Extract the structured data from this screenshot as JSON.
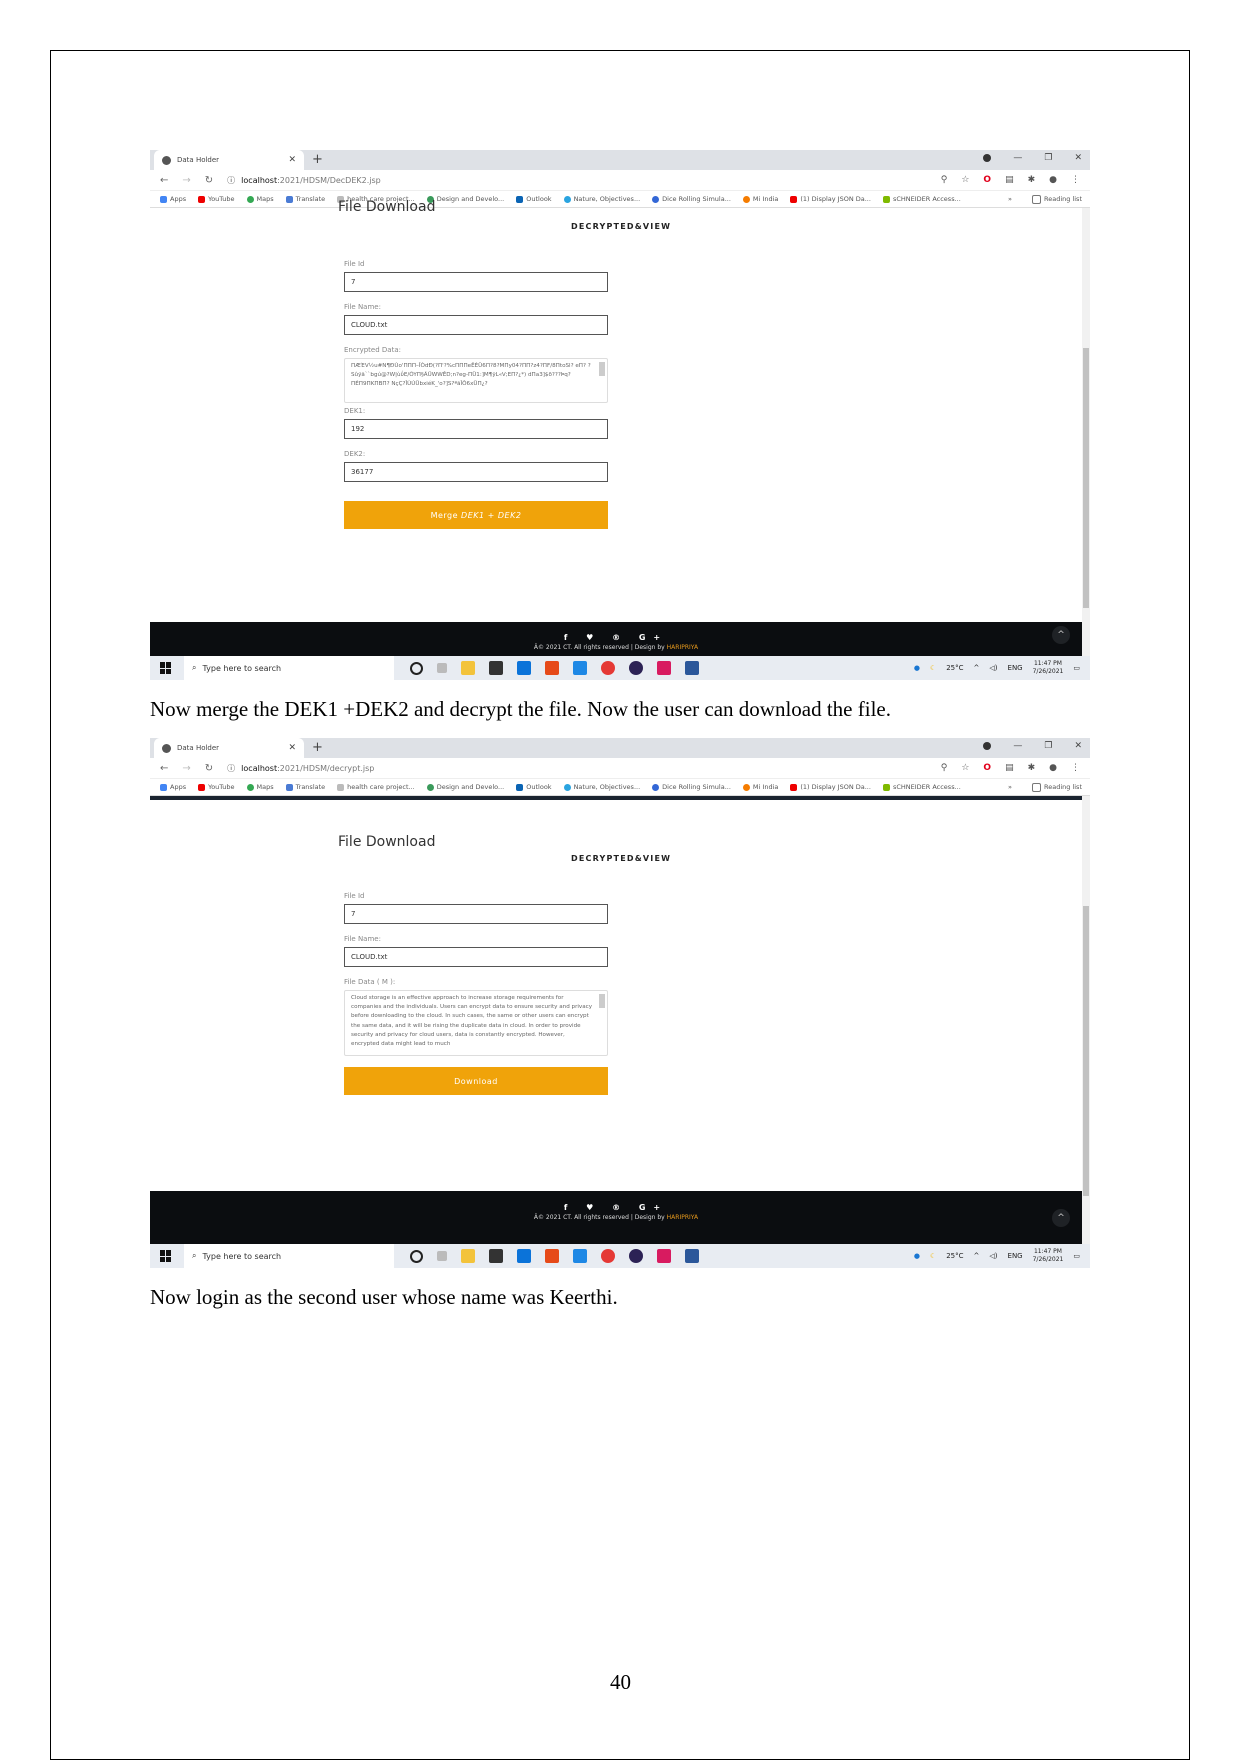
{
  "page_number": "40",
  "captions": [
    "Now merge the DEK1 +DEK2 and decrypt the file. Now the user can download the file.",
    "Now login as the second user whose name was Keerthi."
  ],
  "browser": {
    "tab_title": "Data Holder",
    "bookmarks": [
      "Apps",
      "YouTube",
      "Maps",
      "Translate",
      "health care project...",
      "Design and Develo...",
      "Outlook",
      "Nature, Objectives...",
      "Dice Rolling Simula...",
      "Mi India",
      "(1) Display JSON Da...",
      "sCHNEIDER Access...",
      "»",
      "Reading list"
    ]
  },
  "screenshot1": {
    "url_host": "localhost",
    "url_path": ":2021/HDSM/DecDEK2.jsp",
    "page_title": "File Download",
    "subtitle": "DECRYPTED&VIEW",
    "file_id_label": "File Id",
    "file_id_value": "7",
    "file_name_label": "File Name:",
    "file_name_value": "CLOUD.txt",
    "encrypted_label": "Encrypted Data:",
    "encrypted_value": "ΠÆΈV½u#N¶ÐÙo'ΠΠΠ–ÎÒdÐ(?Π'?%cΠΠΠeÊÈÜ6Π?8?MΠy04?ΠΠ?z4?ΠF/8ΠtoSl? eΠ? ?Sûÿä``bgú@?W|ùΰE/ÕYΠ§ÃÜWWÊD;n?eg-ΠÜ1:]M¶ÿL«V;EΠ?¿*) dΠa3]$ð???Þq?ΠÉΠ9ΠKΠBΠ? NçÇ?ÎÙÚÜbxiéK_'o?]S?ªãÎÔ6xÜΠ¿?",
    "dek1_label": "DEK1:",
    "dek1_value": "192",
    "dek2_label": "DEK2:",
    "dek2_value": "36177",
    "merge_button_prefix": "Merge",
    "merge_button_italic": "DEK1 + DEK2"
  },
  "screenshot2": {
    "url_host": "localhost",
    "url_path": ":2021/HDSM/decrypt.jsp",
    "page_title": "File Download",
    "subtitle": "DECRYPTED&VIEW",
    "file_id_label": "File Id",
    "file_id_value": "7",
    "file_name_label": "File Name:",
    "file_name_value": "CLOUD.txt",
    "file_data_label": "File Data ( M ):",
    "file_data_value": "Cloud storage is an effective approach to increase storage requirements for companies and the individuals. Users can encrypt data to ensure security and privacy before downloading to the cloud. In such cases, the same or other users can encrypt the same data, and it will be rising the duplicate data in cloud. In order to provide security and privacy for cloud users, data is constantly encrypted. However, encrypted data might lead to much",
    "download_button": "Download"
  },
  "footer": {
    "social": "f ♥ ® G+",
    "copyright": "Â© 2021 CT. All rights reserved | Design by",
    "designer": "HARIPRIYA"
  },
  "taskbar": {
    "search_placeholder": "Type here to search",
    "weather": "25°C",
    "lang": "ENG",
    "time": "11:47 PM",
    "date": "7/26/2021"
  }
}
